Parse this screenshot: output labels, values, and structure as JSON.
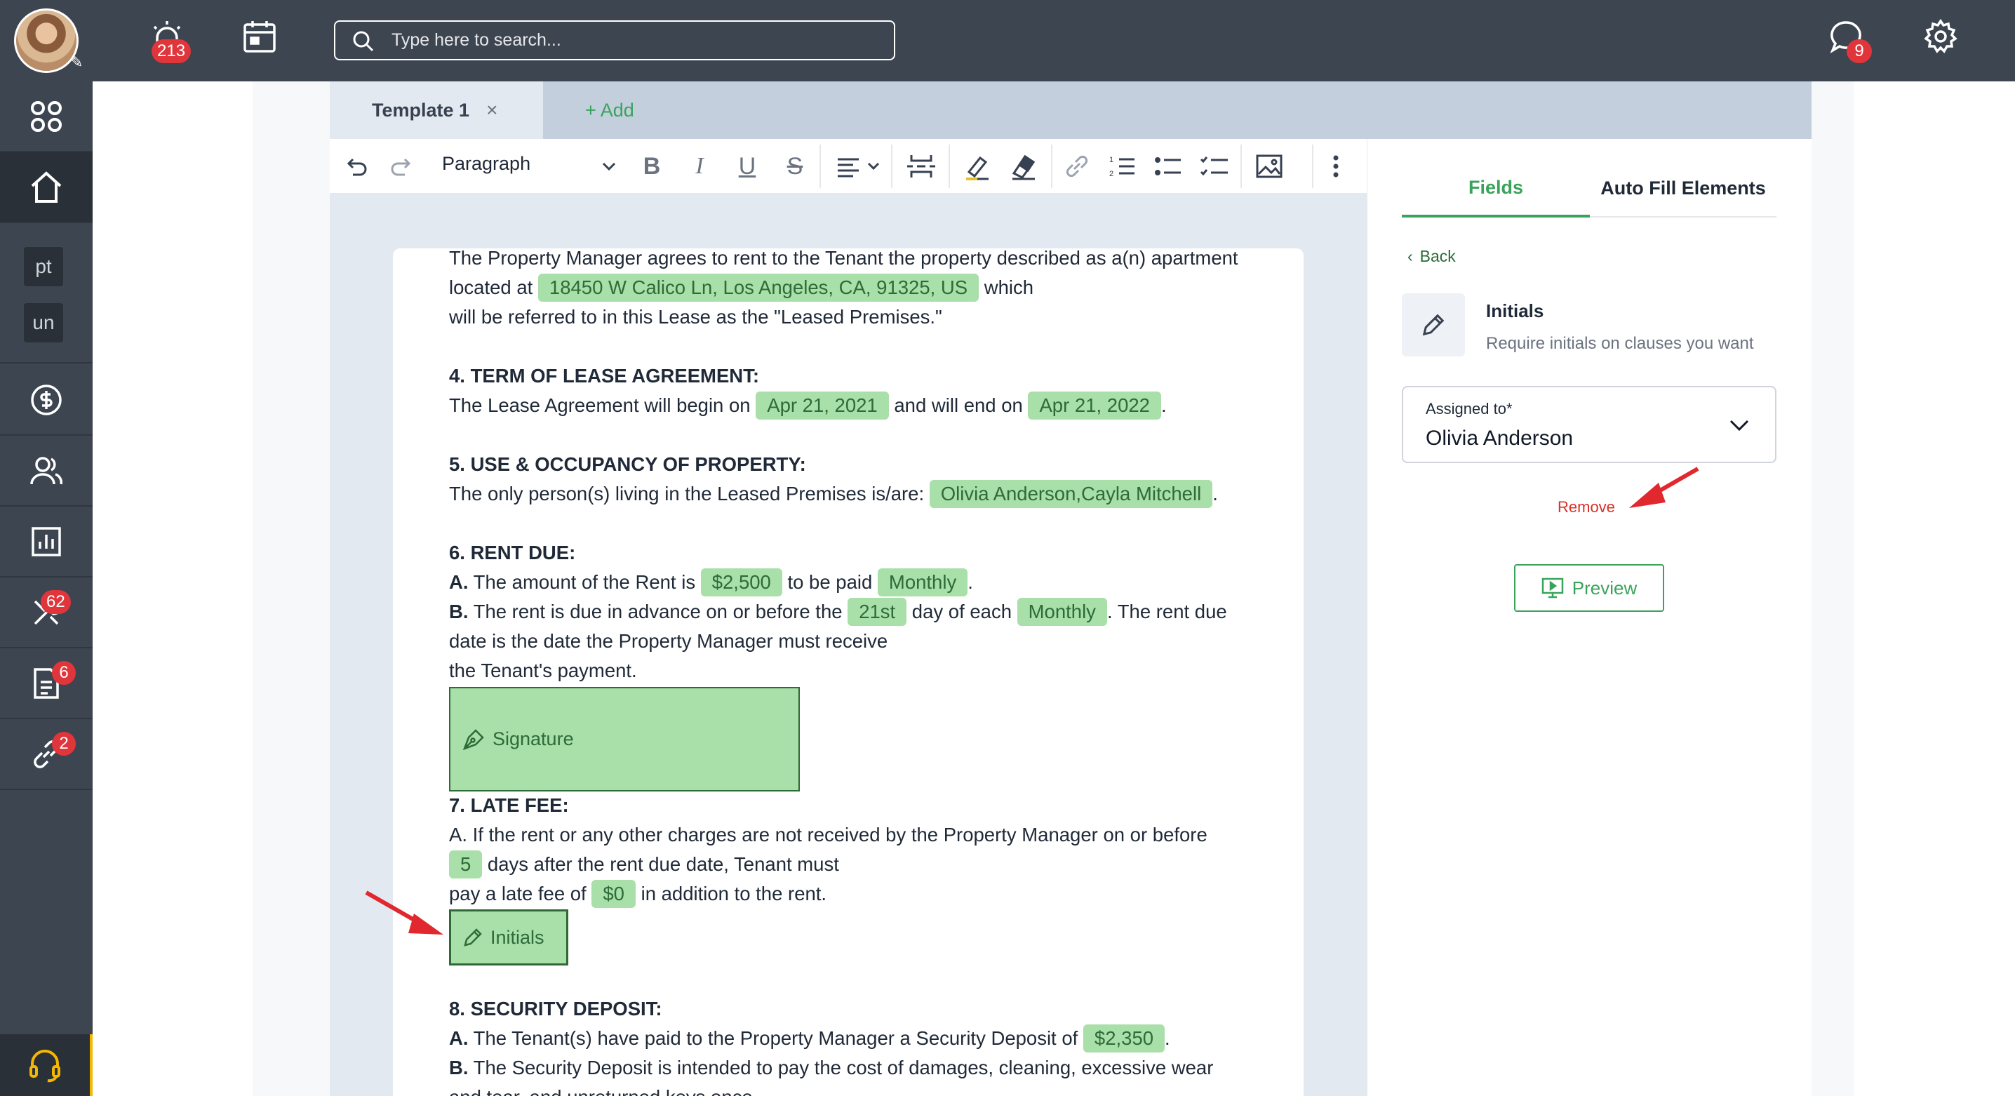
{
  "topbar": {
    "alerts_badge": "213",
    "search_placeholder": "Type here to search...",
    "chat_badge": "9"
  },
  "sidebar": {
    "chip_pt": "pt",
    "chip_un": "un",
    "tools_badge": "62",
    "docs_badge": "6",
    "links_badge": "2"
  },
  "tabs": {
    "template_label": "Template 1",
    "close_glyph": "×",
    "add_label": "+ Add"
  },
  "toolbar": {
    "paragraph_label": "Paragraph"
  },
  "doc": {
    "l1": "The Property Manager agrees to rent to the Tenant the property described as a(n) apartment",
    "l2_pre": "located at ",
    "address": "18450 W Calico Ln, Los Angeles, CA, 91325, US",
    "l2_post": " which",
    "l3": "will be referred to in this Lease as the \"Leased Premises.\"",
    "h4": "4. TERM OF LEASE AGREEMENT:",
    "l4_pre": "The Lease Agreement will begin on ",
    "start_date": "Apr 21, 2021",
    "l4_mid": " and will end on ",
    "end_date": "Apr 21, 2022",
    "l4_post": ".",
    "h5": "5. USE & OCCUPANCY OF PROPERTY:",
    "l5_pre": "The only person(s) living in the Leased Premises is/are: ",
    "occupants": "Olivia Anderson,Cayla Mitchell",
    "l5_post": ".",
    "h6": "6. RENT DUE:",
    "l6a_label": "A.",
    "l6a_pre": " The amount of the Rent is ",
    "rent_amount": "$2,500",
    "l6a_mid": " to be paid ",
    "rent_freq": "Monthly",
    "l6a_post": ".",
    "l6b_label": "B.",
    "l6b_pre": " The rent is due in advance on or before the ",
    "due_day": "21st",
    "l6b_mid": " day of each ",
    "due_freq": "Monthly",
    "l6b_post": ". The rent due",
    "l6c": "date is the date the Property Manager must receive",
    "l6d": "the Tenant's payment.",
    "signature_label": "Signature",
    "h7": "7. LATE FEE:",
    "l7a": "A. If the rent or any other charges are not received by the Property Manager on or before",
    "late_days": "5",
    "l7b_post": " days after the rent due date, Tenant must",
    "l7c_pre": "pay a late fee of ",
    "late_fee": "$0",
    "l7c_post": " in addition to the rent.",
    "initials_label": "Initials",
    "h8": "8. SECURITY DEPOSIT:",
    "l8a_label": "A.",
    "l8a_pre": " The Tenant(s) have paid to the Property Manager a Security Deposit of ",
    "deposit": "$2,350",
    "l8a_post": ".",
    "l8b_label": "B.",
    "l8b": " The Security Deposit is intended to pay the cost of damages, cleaning, excessive wear",
    "l8c": "and tear, and unreturned keys once"
  },
  "right_panel": {
    "tab_fields": "Fields",
    "tab_auto": "Auto Fill Elements",
    "back_label": "Back",
    "field_title": "Initials",
    "field_desc": "Require initials on clauses you want",
    "assigned_label": "Assigned to*",
    "assigned_value": "Olivia Anderson",
    "remove_label": "Remove",
    "preview_label": "Preview"
  },
  "colors": {
    "accent": "#3aa35b",
    "chip_bg": "#a9dfa9",
    "danger": "#d93025",
    "nav_bg": "#3d4550"
  }
}
